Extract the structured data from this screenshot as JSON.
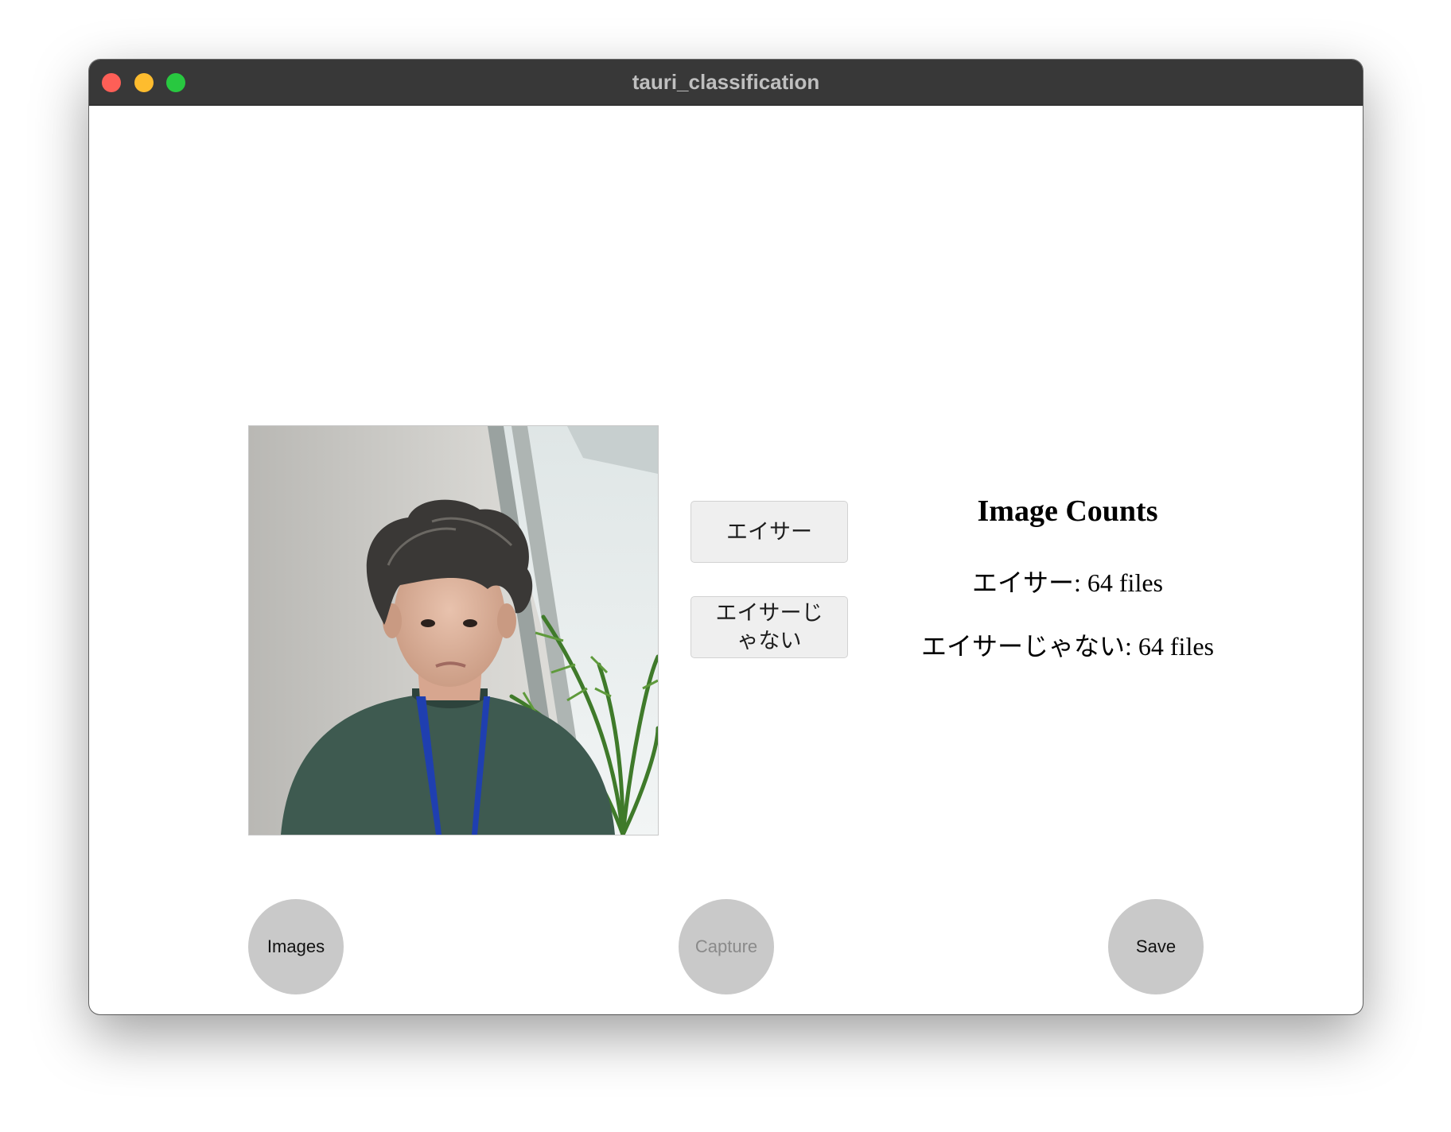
{
  "window": {
    "title": "tauri_classification"
  },
  "classify": {
    "class_a_label": "エイサー",
    "class_b_label": "エイサーじゃない"
  },
  "counts": {
    "heading": "Image Counts",
    "class_a_line": "エイサー: 64 files",
    "class_b_line": "エイサーじゃない: 64 files"
  },
  "actions": {
    "images_label": "Images",
    "capture_label": "Capture",
    "save_label": "Save"
  },
  "colors": {
    "titlebar": "#383838",
    "close": "#fe5f57",
    "minimize": "#febc2e",
    "maximize": "#28c840",
    "round_button": "#c9c9c9",
    "class_button": "#efefef"
  }
}
